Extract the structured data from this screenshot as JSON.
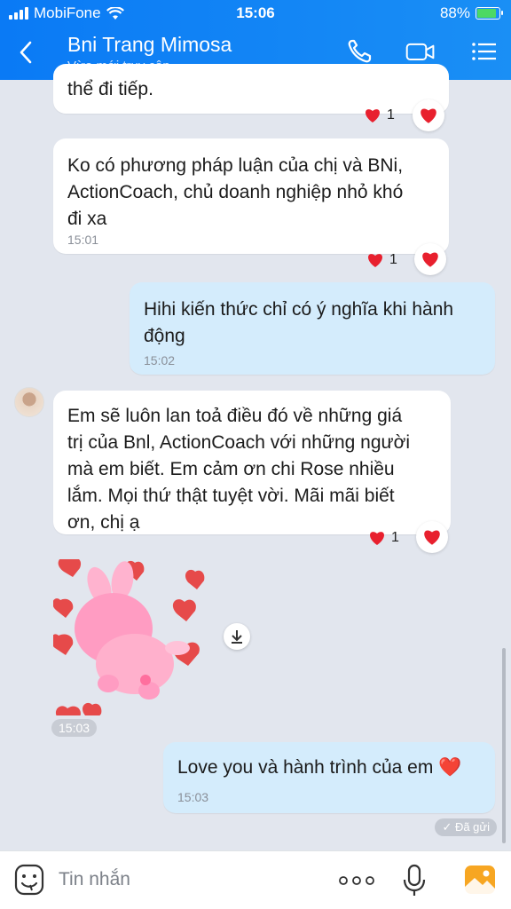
{
  "status": {
    "carrier": "MobiFone",
    "time": "15:06",
    "battery": "88%"
  },
  "header": {
    "title": "Bni Trang Mimosa",
    "subtitle": "Vừa mới truy cập"
  },
  "messages": [
    {
      "text": "thể đi tiếp.",
      "reaction_count": "1"
    },
    {
      "line1": "Ko có phương pháp luận của chị và BNi,",
      "line2": "ActionCoach, chủ doanh nghiệp nhỏ khó",
      "line3": "đi xa",
      "time": "15:01",
      "reaction_count": "1"
    },
    {
      "line1": "Hihi kiến thức chỉ có ý nghĩa khi hành",
      "line2": "động",
      "time": "15:02"
    },
    {
      "line1": "Em sẽ luôn lan toả điều đó về những giá",
      "line2": "trị của Bnl, ActionCoach với những người",
      "line3": "mà em biết. Em cảm ơn chi Rose nhiều",
      "line4": "lắm. Mọi thứ thật tuyệt vời. Mãi mãi biết",
      "line5": "ơn, chị ạ",
      "reaction_count": "1"
    },
    {
      "sticker_time": "15:03"
    },
    {
      "text": "Love you và hành trình của em ❤️",
      "time": "15:03"
    }
  ],
  "sent_status": "✓ Đã gửi",
  "input": {
    "placeholder": "Tin nhắn"
  },
  "colors": {
    "accent": "#0a7af5",
    "my_bubble": "#d4ecfc",
    "heart": "#e8202e"
  }
}
